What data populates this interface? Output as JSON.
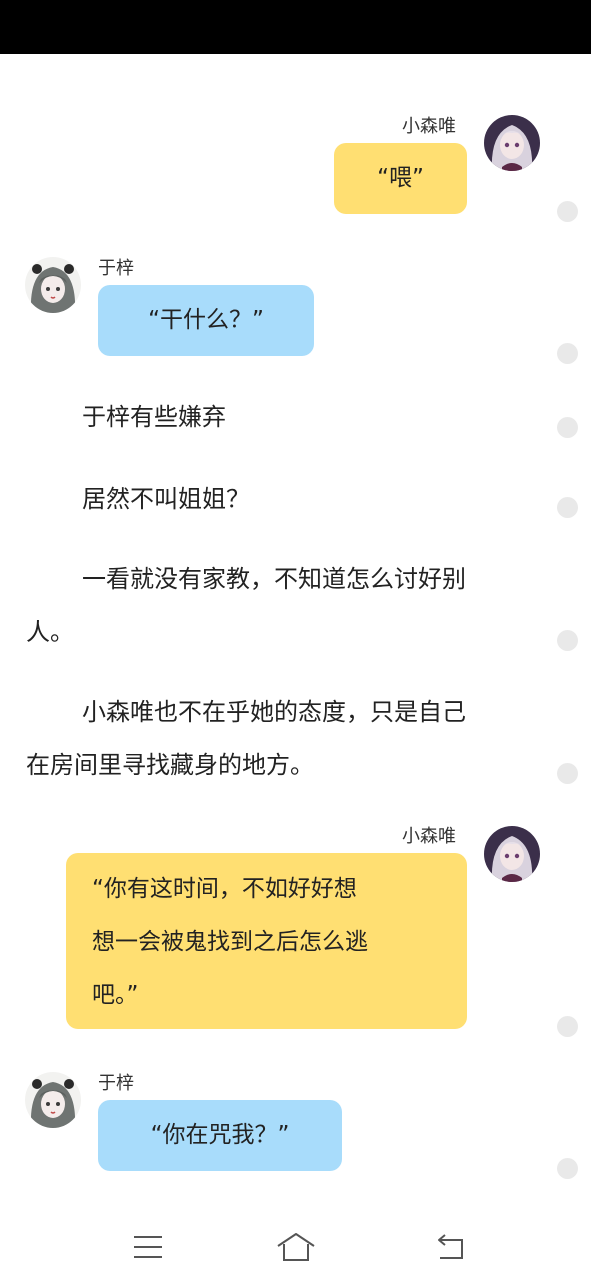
{
  "speakers": {
    "a": "小森唯",
    "b": "于梓"
  },
  "messages": [
    {
      "speaker": "小森唯",
      "text": "“喂”"
    },
    {
      "speaker": "于梓",
      "text": "“干什么？”"
    },
    {
      "speaker": "小森唯",
      "lines": [
        "“你有这时间，不如好好想",
        "想一会被鬼找到之后怎么逃",
        "吧。”"
      ]
    },
    {
      "speaker": "于梓",
      "text": "“你在咒我？”"
    }
  ],
  "narration": [
    {
      "lines": [
        "于梓有些嫌弃"
      ]
    },
    {
      "lines": [
        "居然不叫姐姐？"
      ]
    },
    {
      "lines": [
        "一看就没有家教，不知道怎么讨好别",
        "人。"
      ]
    },
    {
      "lines": [
        "小森唯也不在乎她的态度，只是自己",
        "在房间里寻找藏身的地方。"
      ]
    }
  ],
  "icons": {
    "avatar_a": "avatar-pale-haired-girl",
    "avatar_b": "avatar-gray-haired-girl",
    "nav_menu": "menu-icon",
    "nav_home": "home-icon",
    "nav_back": "back-icon"
  },
  "colors": {
    "bubble_yellow": "#ffdf72",
    "bubble_blue": "#a8dcfb",
    "status_bar": "#000000",
    "dot": "#e9e9e9"
  }
}
